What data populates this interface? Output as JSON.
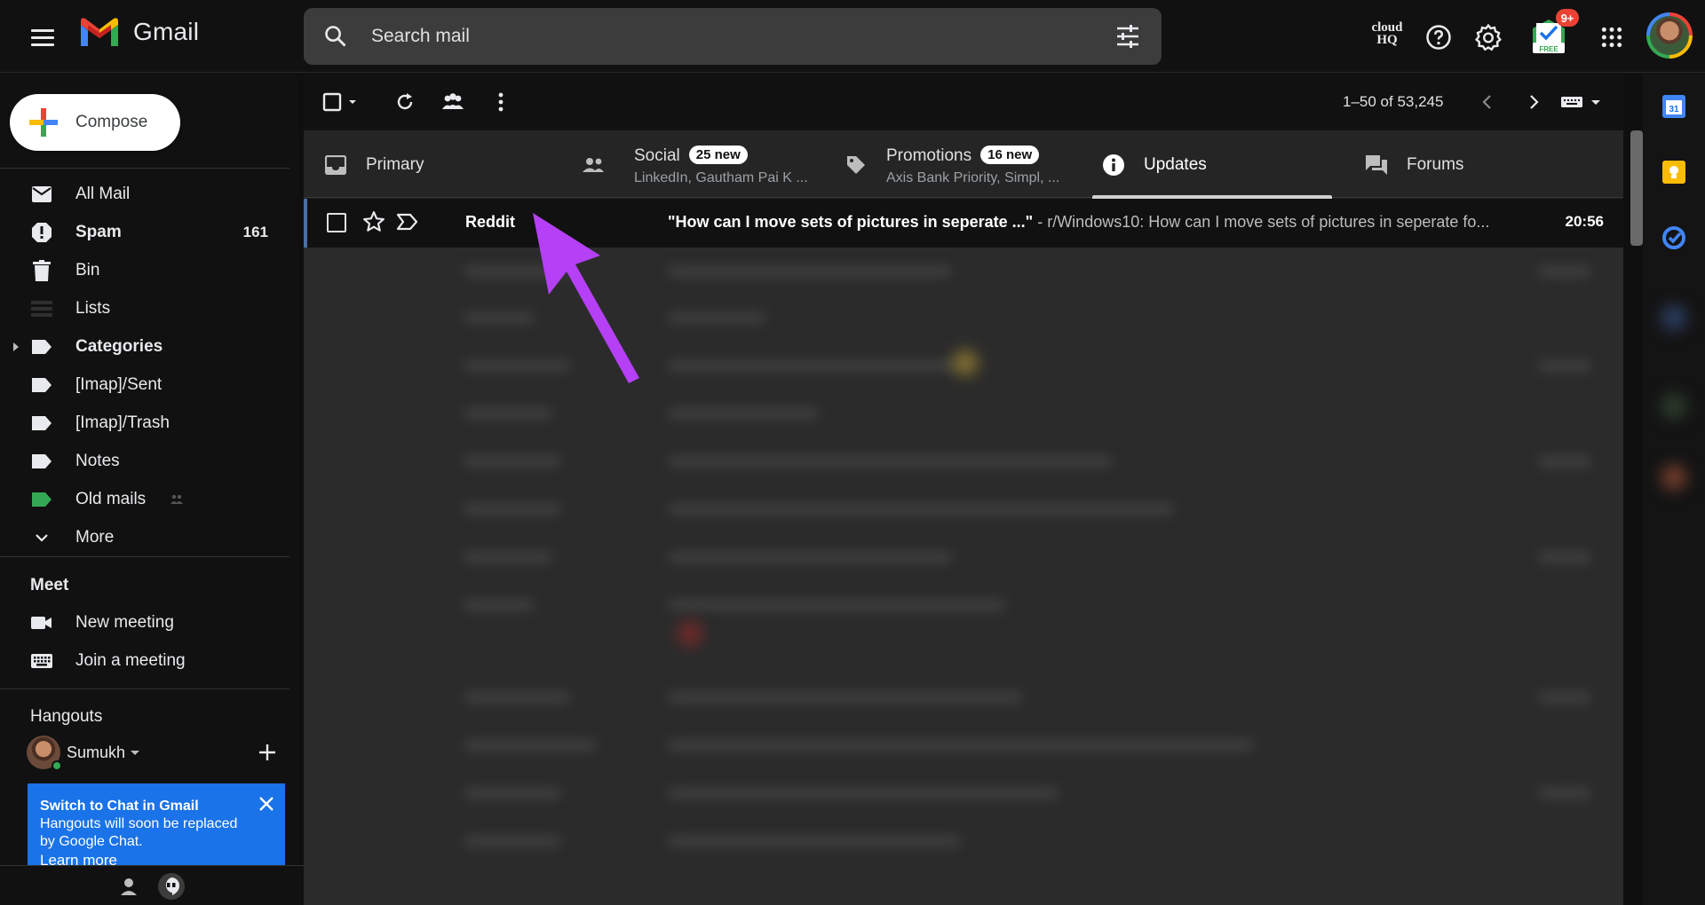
{
  "app": {
    "name": "Gmail"
  },
  "search": {
    "placeholder": "Search mail"
  },
  "header": {
    "cloudhq": "cloud HQ",
    "notification_badge": "9+",
    "free_label": "FREE"
  },
  "compose": {
    "label": "Compose"
  },
  "sidebar": {
    "items": [
      {
        "label": "All Mail",
        "bold": false,
        "count": ""
      },
      {
        "label": "Spam",
        "bold": true,
        "count": "161"
      },
      {
        "label": "Bin",
        "bold": false,
        "count": ""
      },
      {
        "label": "Lists",
        "bold": false,
        "count": ""
      },
      {
        "label": "Categories",
        "bold": true,
        "count": ""
      },
      {
        "label": "[Imap]/Sent",
        "bold": false,
        "count": ""
      },
      {
        "label": "[Imap]/Trash",
        "bold": false,
        "count": ""
      },
      {
        "label": "Notes",
        "bold": false,
        "count": ""
      },
      {
        "label": "Old mails",
        "bold": false,
        "count": ""
      },
      {
        "label": "More",
        "bold": false,
        "count": ""
      }
    ],
    "meet": {
      "title": "Meet",
      "new_meeting": "New meeting",
      "join_meeting": "Join a meeting"
    },
    "hangouts": {
      "title": "Hangouts",
      "user": "Sumukh",
      "banner_title": "Switch to Chat in Gmail",
      "banner_text": "Hangouts will soon be replaced by Google Chat.",
      "banner_link": "Learn more"
    }
  },
  "toolbar": {
    "page_info": "1–50 of 53,245"
  },
  "tabs": [
    {
      "label": "Primary",
      "badge": "",
      "sub": ""
    },
    {
      "label": "Social",
      "badge": "25 new",
      "sub": "LinkedIn, Gautham Pai K ..."
    },
    {
      "label": "Promotions",
      "badge": "16 new",
      "sub": "Axis Bank Priority, Simpl, ..."
    },
    {
      "label": "Updates",
      "badge": "",
      "sub": ""
    },
    {
      "label": "Forums",
      "badge": "",
      "sub": ""
    }
  ],
  "email": {
    "sender": "Reddit",
    "subject": "\"How can I move sets of pictures in seperate ...\"",
    "snippet": " - r/Windows10: How can I move sets of pictures in seperate fo...",
    "time": "20:56"
  },
  "colors": {
    "accent_blue": "#1a73e8",
    "arrow_purple": "#b540f5",
    "label_green": "#34a853",
    "badge_red": "#ea4335"
  }
}
